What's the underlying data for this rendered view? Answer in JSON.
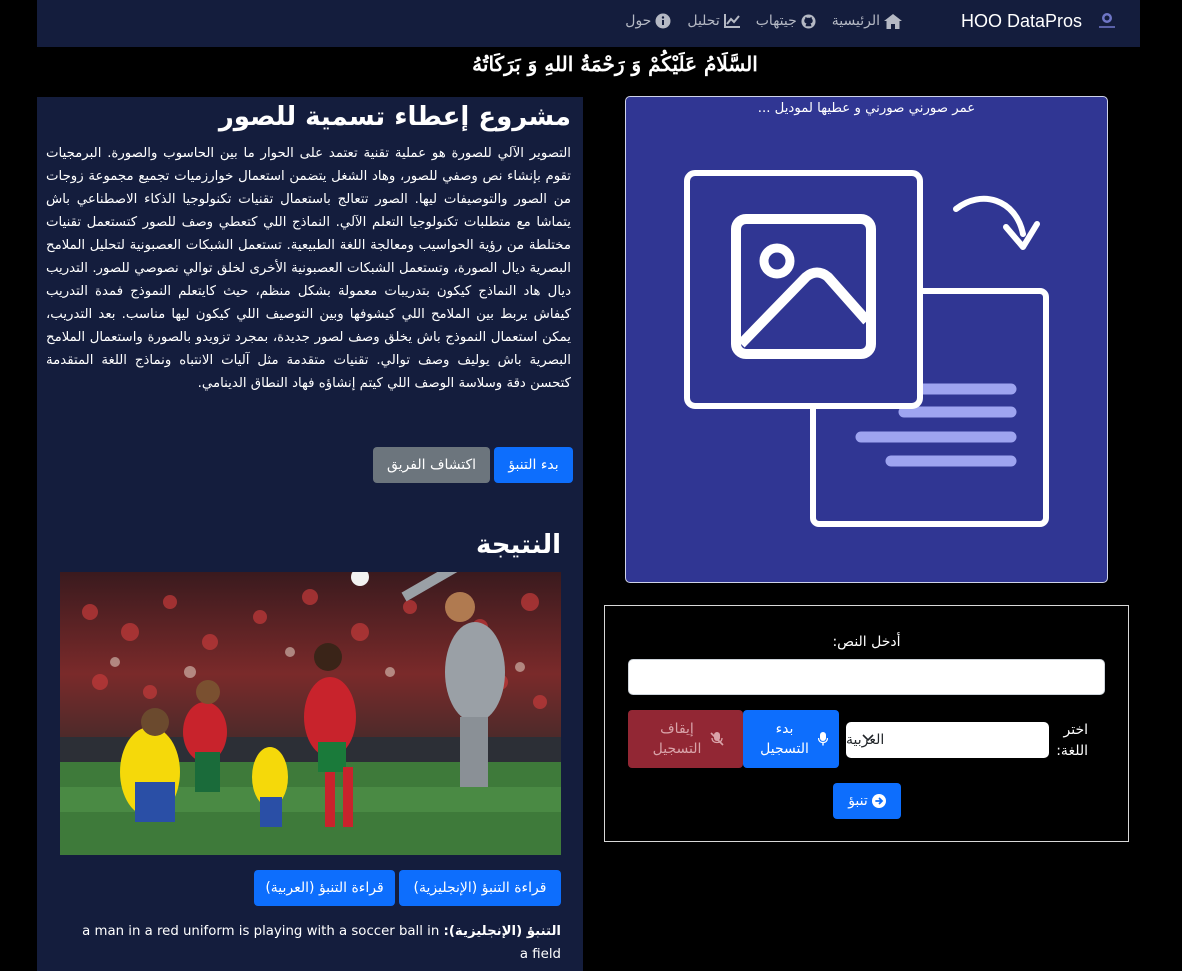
{
  "navbar": {
    "brand": "HOO DataPros",
    "links": [
      {
        "label": "الرئيسية",
        "icon": "home-icon"
      },
      {
        "label": "جيتهاب",
        "icon": "github-icon"
      },
      {
        "label": "تحليل",
        "icon": "chart-line-icon"
      },
      {
        "label": "حول",
        "icon": "info-icon"
      }
    ]
  },
  "greeting": "السَّلَامُ عَلَيْكُمْ وَ رَحْمَةُ اللهِ وَ بَرَكَاتُهُ",
  "project": {
    "title": "مشروع إعطاء تسمية للصور",
    "description": "التصوير الآلي للصورة هو عملية تقنية تعتمد على الحوار ما بين الحاسوب والصورة. البرمجيات تقوم بإنشاء نص وصفي للصور، وهاد الشغل يتضمن استعمال خوارزميات تجميع مجموعة زوجات من الصور والتوصيفات ليها. الصور تتعالج باستعمال تقنيات تكنولوجيا الذكاء الاصطناعي باش يتماشا مع متطلبات تكنولوجيا التعلم الآلي. النماذج اللي كتعطي وصف للصور كتستعمل تقنيات مختلطة من رؤية الحواسيب ومعالجة اللغة الطبيعية. تستعمل الشبكات العصبونية لتحليل الملامح البصرية ديال الصورة، وتستعمل الشبكات العصبونية الأخرى لخلق توالي نصوصي للصور. التدريب ديال هاد النماذج كيكون بتدريبات معمولة بشكل منظم، حيث كايتعلم النموذج فمدة التدريب كيفاش يربط بين الملامح اللي كيشوفها وبين التوصيف اللي كيكون ليها مناسب. بعد التدريب، يمكن استعمال النموذج باش يخلق وصف لصور جديدة، بمجرد تزويدو بالصورة واستعمال الملامح البصرية باش يوليف وصف توالي. تقنيات متقدمة مثل آليات الانتباه ونماذج اللغة المتقدمة كتحسن دقة وسلاسة الوصف اللي كيتم إنشاؤه فهاد النطاق الدينامي.",
    "start_button": "بدء التنبؤ",
    "team_button": "اكتشاف الفريق"
  },
  "result": {
    "title": "النتيجة",
    "read_en_button": "قراءة التنبؤ (الإنجليزية)",
    "read_ar_button": "قراءة التنبؤ (العربية)",
    "prediction_label": "التنبؤ (الإنجليزية):",
    "prediction_text": "a man in a red uniform is playing with a soccer ball in a field"
  },
  "image_card": {
    "caption": "عمر صورني صورني و عطيها لموديل ..."
  },
  "form": {
    "text_label": "أدخل النص:",
    "text_value": "",
    "language_label": "اختر اللغة:",
    "language_selected": "العربية",
    "record_start_button": "بدء التسجيل",
    "record_stop_button": "إيقاف التسجيل",
    "predict_button": "تنبؤ"
  },
  "colors": {
    "navbar_bg": "#141d3d",
    "panel_bg": "#141d3d",
    "card_bg": "#303693",
    "primary": "#0d6efd",
    "secondary": "#6c757d",
    "danger_disabled": "#922734"
  }
}
